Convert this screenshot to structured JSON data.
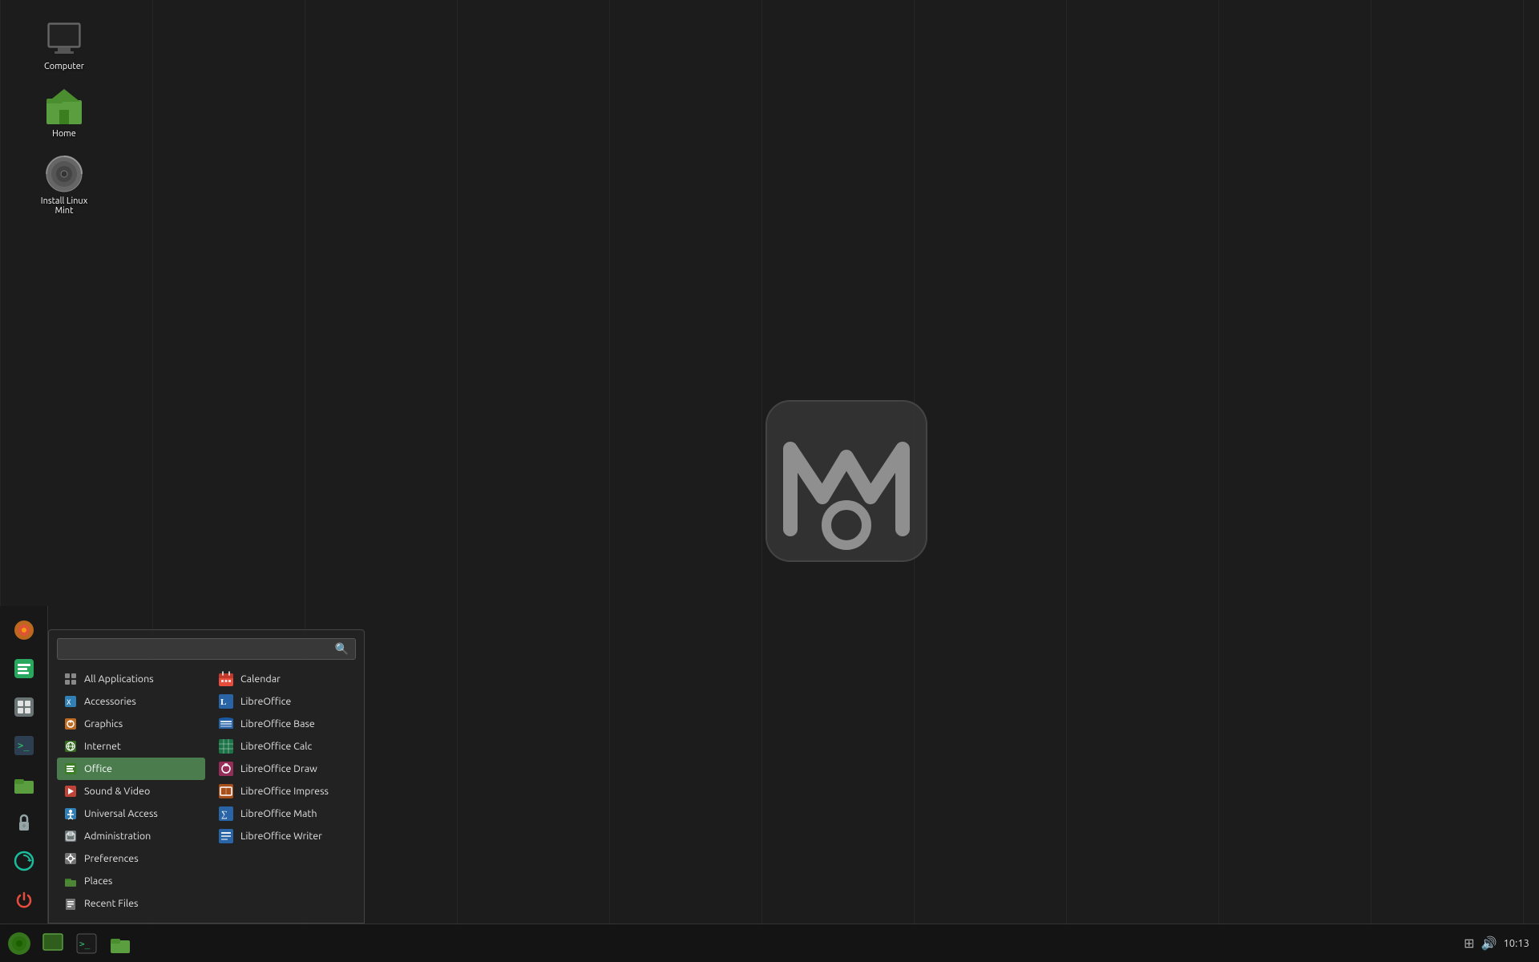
{
  "desktop": {
    "icons": [
      {
        "id": "computer",
        "label": "Computer",
        "type": "computer"
      },
      {
        "id": "home",
        "label": "Home",
        "type": "home"
      },
      {
        "id": "install",
        "label": "Install Linux Mint",
        "type": "dvd"
      }
    ]
  },
  "taskbar": {
    "time": "10:13",
    "buttons": [
      {
        "id": "mint-menu",
        "type": "mint"
      },
      {
        "id": "show-desktop",
        "type": "desktop"
      },
      {
        "id": "terminal",
        "type": "terminal"
      },
      {
        "id": "files",
        "type": "files"
      }
    ]
  },
  "sidebar": {
    "buttons": [
      {
        "id": "firefox",
        "type": "firefox"
      },
      {
        "id": "app2",
        "type": "green"
      },
      {
        "id": "app3",
        "type": "gray"
      },
      {
        "id": "terminal",
        "type": "terminal"
      },
      {
        "id": "folder",
        "type": "folder"
      },
      {
        "id": "lock",
        "type": "lock"
      },
      {
        "id": "update",
        "type": "update"
      },
      {
        "id": "power",
        "type": "power"
      }
    ]
  },
  "app_menu": {
    "search": {
      "placeholder": "",
      "value": ""
    },
    "categories": [
      {
        "id": "all-apps",
        "label": "All Applications",
        "icon": "grid"
      },
      {
        "id": "accessories",
        "label": "Accessories",
        "icon": "tool"
      },
      {
        "id": "graphics",
        "label": "Graphics",
        "icon": "graphics"
      },
      {
        "id": "internet",
        "label": "Internet",
        "icon": "internet"
      },
      {
        "id": "office",
        "label": "Office",
        "icon": "office",
        "active": true
      },
      {
        "id": "sound-video",
        "label": "Sound & Video",
        "icon": "media"
      },
      {
        "id": "universal-access",
        "label": "Universal Access",
        "icon": "access"
      },
      {
        "id": "administration",
        "label": "Administration",
        "icon": "admin"
      },
      {
        "id": "preferences",
        "label": "Preferences",
        "icon": "prefs"
      },
      {
        "id": "places",
        "label": "Places",
        "icon": "places"
      },
      {
        "id": "recent-files",
        "label": "Recent Files",
        "icon": "recent"
      }
    ],
    "apps": [
      {
        "id": "calendar",
        "label": "Calendar",
        "icon": "calendar"
      },
      {
        "id": "libreoffice",
        "label": "LibreOffice",
        "icon": "lo"
      },
      {
        "id": "lo-base",
        "label": "LibreOffice Base",
        "icon": "lo-base"
      },
      {
        "id": "lo-calc",
        "label": "LibreOffice Calc",
        "icon": "lo-calc"
      },
      {
        "id": "lo-draw",
        "label": "LibreOffice Draw",
        "icon": "lo-draw"
      },
      {
        "id": "lo-impress",
        "label": "LibreOffice Impress",
        "icon": "lo-impress"
      },
      {
        "id": "lo-math",
        "label": "LibreOffice Math",
        "icon": "lo-math"
      },
      {
        "id": "lo-writer",
        "label": "LibreOffice Writer",
        "icon": "lo-writer"
      }
    ]
  }
}
